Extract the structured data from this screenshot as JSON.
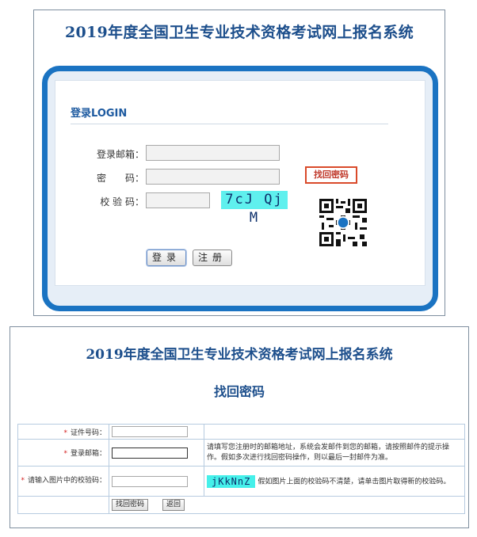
{
  "login": {
    "title": "2019年度全国卫生专业技术资格考试网上报名系统",
    "heading": "登录LOGIN",
    "email_label": "登录邮箱：",
    "password_label": "密　　码：",
    "captcha_label": "校 验 码：",
    "captcha_text": "7cJ Qj M",
    "find_password_button": "找回密码",
    "login_button": "登录",
    "register_button": "注册"
  },
  "recover": {
    "title": "2019年度全国卫生专业技术资格考试网上报名系统",
    "subtitle": "找回密码",
    "required_mark": "*",
    "id_label": "证件号码：",
    "email_label": "登录邮箱：",
    "email_hint": "请填写您注册时的邮箱地址，系统会发邮件到您的邮箱，请按照邮件的提示操作。假如多次进行找回密码操作，则以最后一封邮件为准。",
    "captcha_label": "请输入图片中的校验码：",
    "captcha_text": "jKkNnZ",
    "captcha_hint": "假如图片上面的校验码不清楚，请单击图片取得新的校验码。",
    "find_button": "找回密码",
    "back_button": "返回"
  },
  "colors": {
    "title_blue": "#1d4f8c",
    "frame_blue": "#1a73c2",
    "captcha_cyan": "#5ff0ee",
    "highlight_red": "#d94a2a"
  }
}
